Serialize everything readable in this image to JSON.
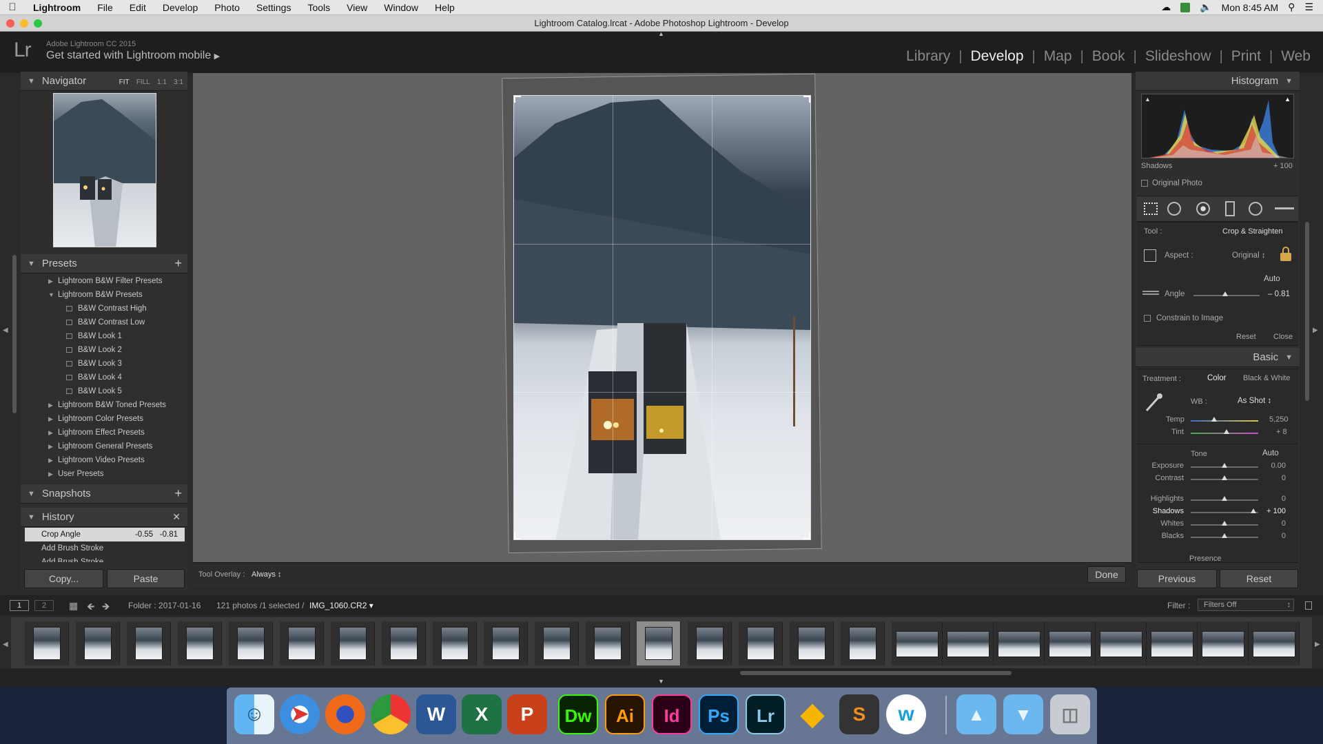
{
  "menubar": {
    "app": "Lightroom",
    "items": [
      "File",
      "Edit",
      "Develop",
      "Photo",
      "Settings",
      "Tools",
      "View",
      "Window",
      "Help"
    ],
    "clock": "Mon 8:45 AM"
  },
  "window": {
    "title": "Lightroom Catalog.lrcat - Adobe Photoshop Lightroom - Develop"
  },
  "header": {
    "logo": "Lr",
    "product": "Adobe Lightroom CC 2015",
    "mobile": "Get started with Lightroom mobile",
    "modules": [
      "Library",
      "Develop",
      "Map",
      "Book",
      "Slideshow",
      "Print",
      "Web"
    ],
    "active_module": "Develop"
  },
  "left": {
    "navigator": {
      "title": "Navigator",
      "opts": [
        "FIT",
        "FILL",
        "1:1",
        "3:1"
      ]
    },
    "presets": {
      "title": "Presets",
      "items": [
        {
          "label": "Lightroom B&W Filter Presets",
          "type": "folder"
        },
        {
          "label": "Lightroom B&W Presets",
          "type": "open"
        },
        {
          "label": "B&W Contrast High",
          "type": "preset"
        },
        {
          "label": "B&W Contrast Low",
          "type": "preset"
        },
        {
          "label": "B&W Look 1",
          "type": "preset"
        },
        {
          "label": "B&W Look 2",
          "type": "preset"
        },
        {
          "label": "B&W Look 3",
          "type": "preset"
        },
        {
          "label": "B&W Look 4",
          "type": "preset"
        },
        {
          "label": "B&W Look 5",
          "type": "preset"
        },
        {
          "label": "Lightroom B&W Toned Presets",
          "type": "folder"
        },
        {
          "label": "Lightroom Color Presets",
          "type": "folder"
        },
        {
          "label": "Lightroom Effect Presets",
          "type": "folder"
        },
        {
          "label": "Lightroom General Presets",
          "type": "folder"
        },
        {
          "label": "Lightroom Video Presets",
          "type": "folder"
        },
        {
          "label": "User Presets",
          "type": "folder"
        }
      ]
    },
    "snapshots": {
      "title": "Snapshots"
    },
    "history": {
      "title": "History",
      "items": [
        {
          "label": "Crop Angle",
          "v1": "-0.55",
          "v2": "-0.81"
        },
        {
          "label": "Add Brush Stroke",
          "v1": "",
          "v2": ""
        },
        {
          "label": "Add Brush Stroke",
          "v1": "",
          "v2": ""
        }
      ]
    },
    "copy_label": "Copy...",
    "paste_label": "Paste"
  },
  "toolbar": {
    "overlay_label": "Tool Overlay :",
    "overlay_value": "Always",
    "done_label": "Done"
  },
  "right": {
    "histogram": {
      "title": "Histogram",
      "shadows_label": "Shadows",
      "shadows_value": "+ 100",
      "original_photo": "Original Photo"
    },
    "crop": {
      "tool_label": "Tool :",
      "tool_value": "Crop & Straighten",
      "aspect_label": "Aspect :",
      "aspect_value": "Original",
      "auto_label": "Auto",
      "angle_label": "Angle",
      "angle_value": "– 0.81",
      "constrain_label": "Constrain to Image",
      "reset_label": "Reset",
      "close_label": "Close"
    },
    "basic": {
      "title": "Basic",
      "treatment_label": "Treatment :",
      "color_label": "Color",
      "bw_label": "Black & White",
      "wb_label": "WB :",
      "wb_value": "As Shot",
      "temp_label": "Temp",
      "temp_value": "5,250",
      "tint_label": "Tint",
      "tint_value": "+ 8",
      "tone_label": "Tone",
      "tone_auto": "Auto",
      "sliders": [
        {
          "label": "Exposure",
          "value": "0.00",
          "pos": 0.5
        },
        {
          "label": "Contrast",
          "value": "0",
          "pos": 0.5
        },
        {
          "label": "Highlights",
          "value": "0",
          "pos": 0.5
        },
        {
          "label": "Shadows",
          "value": "+ 100",
          "pos": 0.93
        },
        {
          "label": "Whites",
          "value": "0",
          "pos": 0.5
        },
        {
          "label": "Blacks",
          "value": "0",
          "pos": 0.5
        }
      ],
      "presence_label": "Presence"
    },
    "previous_label": "Previous",
    "reset_label": "Reset"
  },
  "filmbar": {
    "page1": "1",
    "page2": "2",
    "folder": "Folder : 2017-01-16",
    "count": "121 photos /1 selected /",
    "filename": "IMG_1060.CR2",
    "filter_label": "Filter :",
    "filter_value": "Filters Off"
  }
}
